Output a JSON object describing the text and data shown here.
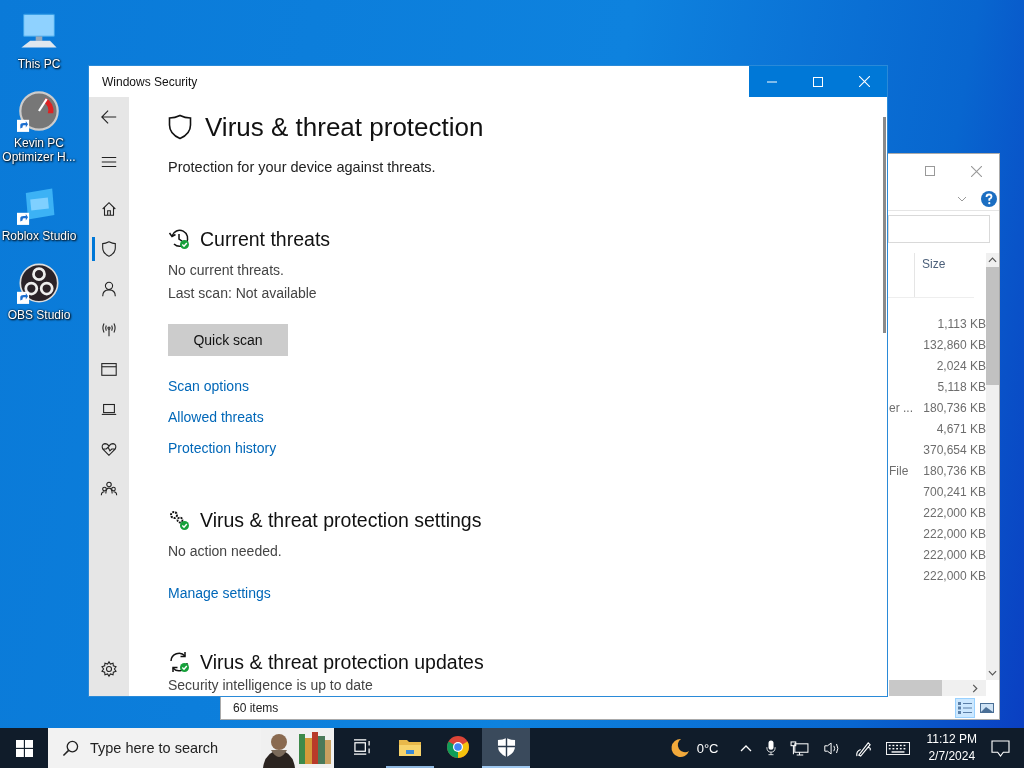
{
  "desktop_icons": [
    {
      "kind": "computer",
      "label": "This PC",
      "shortcut": false
    },
    {
      "kind": "gauge",
      "label": "Kevin PC Optimizer H...",
      "shortcut": true
    },
    {
      "kind": "studio",
      "label": "Roblox Studio",
      "shortcut": true
    },
    {
      "kind": "obs",
      "label": "OBS Studio",
      "shortcut": true
    }
  ],
  "explorer": {
    "size_header": "Size",
    "rows": [
      {
        "size": "1,113 KB"
      },
      {
        "size": "132,860 KB"
      },
      {
        "size": "2,024 KB"
      },
      {
        "size": "5,118 KB"
      },
      {
        "cut_text": "er ...",
        "size": "180,736 KB"
      },
      {
        "size": "4,671 KB"
      },
      {
        "size": "370,654 KB"
      },
      {
        "cut_text": "File",
        "size": "180,736 KB"
      },
      {
        "size": "700,241 KB"
      },
      {
        "size": "222,000 KB"
      },
      {
        "size": "222,000 KB"
      },
      {
        "size": "222,000 KB"
      },
      {
        "size": "222,000 KB"
      }
    ],
    "status": "60 items",
    "views": [
      {
        "kind": "details",
        "selected": true
      },
      {
        "kind": "large_icons",
        "selected": false
      }
    ]
  },
  "security": {
    "title": "Windows Security",
    "nav": [
      {
        "kind": "back",
        "selected": false
      },
      {
        "kind": "menu",
        "selected": false
      },
      {
        "kind": "home",
        "selected": false
      },
      {
        "kind": "shield",
        "selected": true
      },
      {
        "kind": "account",
        "selected": false
      },
      {
        "kind": "network",
        "selected": false
      },
      {
        "kind": "browser",
        "selected": false
      },
      {
        "kind": "device",
        "selected": false
      },
      {
        "kind": "health",
        "selected": false
      },
      {
        "kind": "family",
        "selected": false
      },
      {
        "kind": "settings",
        "selected": false
      }
    ],
    "page": {
      "title": "Virus & threat protection",
      "subtitle": "Protection for your device against threats.",
      "sections": [
        {
          "kind": "threats",
          "heading": "Current threats",
          "lines": [
            "No current threats.",
            "Last scan: Not available"
          ],
          "button": "Quick scan",
          "links": [
            "Scan options",
            "Allowed threats",
            "Protection history"
          ]
        },
        {
          "kind": "settings",
          "heading": "Virus & threat protection settings",
          "lines": [
            "No action needed."
          ],
          "links": [
            "Manage settings"
          ]
        },
        {
          "kind": "updates",
          "heading": "Virus & threat protection updates",
          "lines": [
            "Security intelligence is up to date"
          ]
        }
      ]
    }
  },
  "taskbar": {
    "search": {
      "placeholder": "Type here to search"
    },
    "apps": [
      {
        "kind": "task_view",
        "running": false,
        "selected": false
      },
      {
        "kind": "file_explorer",
        "running": true,
        "selected": false
      },
      {
        "kind": "chrome",
        "running": false,
        "selected": false
      },
      {
        "kind": "security",
        "running": true,
        "selected": true
      }
    ],
    "weather": "0°C",
    "time": "11:12 PM",
    "date": "2/7/2024"
  }
}
